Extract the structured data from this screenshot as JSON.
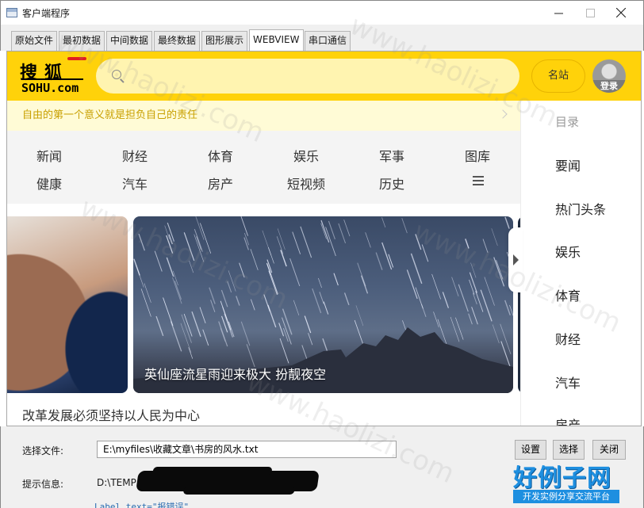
{
  "window": {
    "title": "客户端程序",
    "min_icon": "minimize-icon",
    "max_icon": "maximize-icon",
    "close_icon": "close-icon"
  },
  "tabs": [
    {
      "label": "原始文件",
      "active": false
    },
    {
      "label": "最初数据",
      "active": false
    },
    {
      "label": "中间数据",
      "active": false
    },
    {
      "label": "最终数据",
      "active": false
    },
    {
      "label": "图形展示",
      "active": false
    },
    {
      "label": "WEBVIEW",
      "active": true
    },
    {
      "label": "串口通信",
      "active": false
    }
  ],
  "webview": {
    "logo": {
      "cn": "搜狐",
      "en": "SOHU.com"
    },
    "search": {
      "placeholder": ""
    },
    "site_button": "名站",
    "login_label": "登录",
    "slogan": "自由的第一个意义就是担负自己的责任",
    "nav": [
      "新闻",
      "财经",
      "体育",
      "娱乐",
      "军事",
      "图库",
      "健康",
      "汽车",
      "房产",
      "短视频",
      "历史"
    ],
    "slide_caption": "英仙座流星雨迎来极大 扮靓夜空",
    "slide_count": 7,
    "slide_active": 0,
    "headline": "改革发展必须坚持以人民为中心",
    "sidebar": {
      "title": "目录",
      "items": [
        "要闻",
        "热门头条",
        "娱乐",
        "体育",
        "财经",
        "汽车",
        "房产"
      ]
    },
    "colors": {
      "brand_yellow": "#ffd20a",
      "slogan_text": "#c8a000"
    }
  },
  "bottom": {
    "file_label": "选择文件:",
    "file_value": "E:\\myfiles\\收藏文章\\书房的风水.txt",
    "settings_button": "设置",
    "select_button": "选择",
    "close_button": "关闭",
    "info_label": "提示信息:",
    "info_value": "D:\\TEMP",
    "code_hint": "Label text=\"报错误\"",
    "brand_big": "好例子网",
    "brand_small": "开发实例分享交流平台"
  },
  "watermark": "www.haolizi.com"
}
